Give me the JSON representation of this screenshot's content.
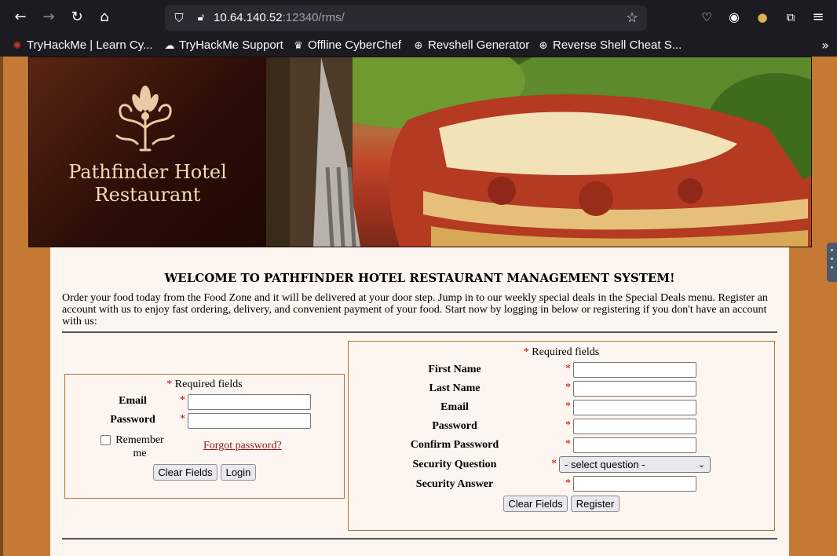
{
  "browser": {
    "url_host": "10.64.140.52",
    "url_rest": ":12340/rms/",
    "bookmarks": [
      {
        "label": "TryHackMe | Learn Cy...",
        "icon": "tryhackme-icon"
      },
      {
        "label": "TryHackMe Support",
        "icon": "cloud-icon"
      },
      {
        "label": "Offline CyberChef",
        "icon": "chef-icon"
      },
      {
        "label": "Revshell Generator",
        "icon": "globe-icon"
      },
      {
        "label": "Reverse Shell Cheat S...",
        "icon": "globe-icon"
      }
    ]
  },
  "banner": {
    "title_line1": "Pathfinder Hotel",
    "title_line2": "Restaurant"
  },
  "main": {
    "headline": "WELCOME TO PATHFINDER HOTEL RESTAURANT MANAGEMENT SYSTEM!",
    "intro": "Order your food today from the Food Zone and it will be delivered at your door step. Jump in to our weekly special deals in the Special Deals menu. Register an account with us to enjoy fast ordering, delivery, and convenient payment of your food. Start now by logging in below or registering if you don't have an account with us:"
  },
  "login": {
    "required_note": "Required fields",
    "required_mark": "*",
    "email_label": "Email",
    "password_label": "Password",
    "remember_line1": "Remember",
    "remember_line2": "me",
    "forgot_link": "Forgot password?",
    "clear_button": "Clear Fields",
    "login_button": "Login"
  },
  "register": {
    "required_note": "Required fields",
    "required_mark": "*",
    "first_name_label": "First Name",
    "last_name_label": "Last Name",
    "email_label": "Email",
    "password_label": "Password",
    "confirm_password_label": "Confirm Password",
    "security_question_label": "Security Question",
    "security_question_selected": "- select question -",
    "security_answer_label": "Security Answer",
    "clear_button": "Clear Fields",
    "register_button": "Register"
  }
}
